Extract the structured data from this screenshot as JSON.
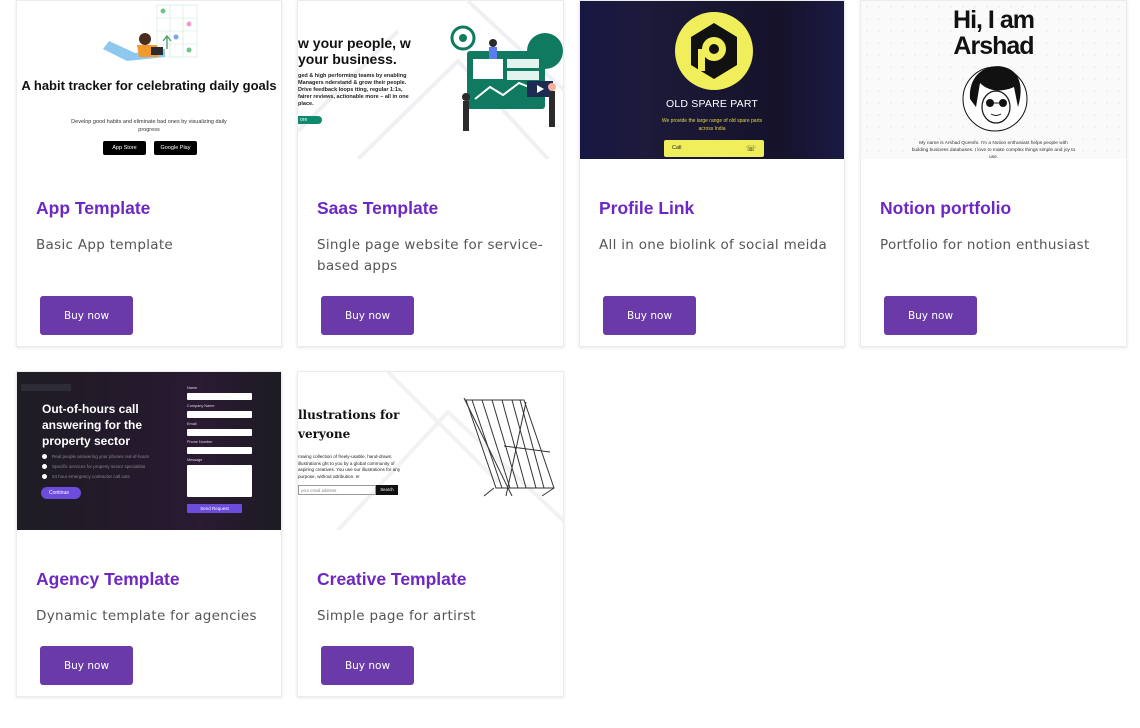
{
  "accent_title_color": "#6d28c4",
  "button_color": "#6a3aa8",
  "cards": [
    {
      "title": "App Template",
      "description": "Basic App template",
      "button_label": "Buy now",
      "preview": {
        "heading": "A habit tracker for celebrating daily goals",
        "body": "Develop good habits and eliminate bad ones by visualizing daily progress",
        "app_store": "App Store",
        "google_play": "Google Play"
      }
    },
    {
      "title": "Saas Template",
      "description": "Single page website for service-based apps",
      "button_label": "Buy now",
      "preview": {
        "heading": "w your people, w your business.",
        "body": "ged & high performing teams by enabling Managers nderstand & grow their people. Drive feedback loops tting, regular 1:1s, fairer reviews, actionable more – all in one place.",
        "cta": "ore"
      }
    },
    {
      "title": "Profile Link",
      "description": "All in one biolink of social meida",
      "button_label": "Buy now",
      "preview": {
        "name": "OLD SPARE PART",
        "body": "We provide the large range of old spare parts across India",
        "call": "Call"
      }
    },
    {
      "title": "Notion portfolio",
      "description": "Portfolio for notion enthusiast",
      "button_label": "Buy now",
      "preview": {
        "heading": "Hi, I am Arshad",
        "body": "My name is Arshad Qureshi. I'm a Notion enthusiast helps people with building business databases. I love to make complex things simple and joy to use."
      }
    },
    {
      "title": "Agency Template",
      "description": "Dynamic template for agencies",
      "button_label": "Buy now",
      "preview": {
        "heading": "Out-of-hours call answering for the property sector",
        "points": [
          "Real people answering your phones out-of-hours",
          "Specific services for property sector specialists",
          "24 hour emergency contractor call outs"
        ],
        "continue": "Continue",
        "fields": [
          "Name",
          "Company Name",
          "Email",
          "Phone Number",
          "Message"
        ],
        "send": "Send Request"
      }
    },
    {
      "title": "Creative Template",
      "description": "Simple page for artirst",
      "button_label": "Buy now",
      "preview": {
        "heading": "llustrations for veryone",
        "body": "rowing collection of freely-usable, hand-drawn illustrations ght to you by a global community of aspiring creatives. You use our illustrations for any purpose, without attribution. e!",
        "input": "your email address",
        "search": "Search"
      }
    }
  ]
}
